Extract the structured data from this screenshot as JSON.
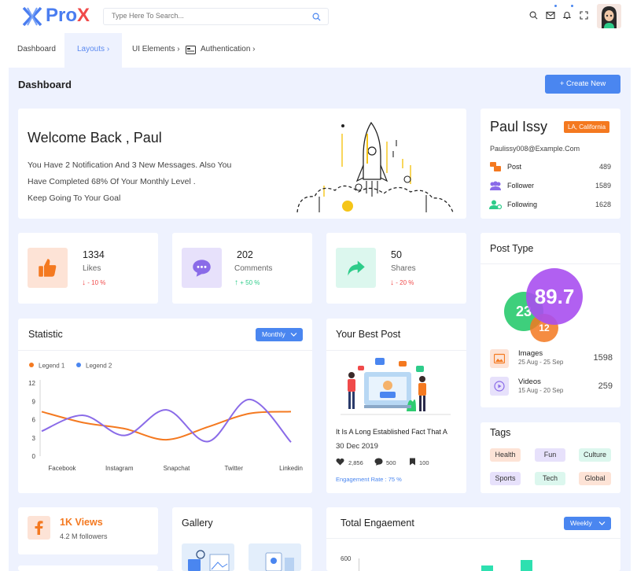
{
  "app": {
    "logo_prefix": "Pro",
    "logo_suffix": "X"
  },
  "search": {
    "placeholder": "Type Here To Search..."
  },
  "nav": [
    {
      "label": "Dashboard"
    },
    {
      "label": "Layouts",
      "chevron": "›"
    },
    {
      "label": "UI Elements",
      "chevron": "›"
    },
    {
      "label": "Authentication",
      "chevron": "›"
    }
  ],
  "page": {
    "title": "Dashboard",
    "create_button": "Create New",
    "create_icon": "+"
  },
  "welcome": {
    "title": "Welcome Back , Paul",
    "lines": [
      "You Have 2 Notification And 3 New Messages. Also You",
      "Have Completed 68% Of Your Monthly Level .",
      "Keep Going To Your Goal"
    ]
  },
  "profile": {
    "name": "Paul Issy",
    "location": "LA, California",
    "email": "Paulissy008@Example.Com",
    "stats": [
      {
        "label": "Post",
        "value": "489",
        "icon": "post-icon",
        "color": "#f47920"
      },
      {
        "label": "Follower",
        "value": "1589",
        "icon": "followers-icon",
        "color": "#8a6be8"
      },
      {
        "label": "Following",
        "value": "1628",
        "icon": "following-icon",
        "color": "#2ecc8a"
      }
    ]
  },
  "stats": [
    {
      "value": "1334",
      "label": "Likes",
      "trend": "- 10 %",
      "direction": "down",
      "icon": "thumbs-up-icon",
      "bg": "#fde3d6",
      "fg": "#f47920",
      "trend_color": "#f04a4a"
    },
    {
      "value": "202",
      "label": "Comments",
      "trend": "+ 50 %",
      "direction": "up",
      "icon": "comment-icon",
      "bg": "#e7e1fb",
      "fg": "#8a6be8",
      "trend_color": "#2ecc8a"
    },
    {
      "value": "50",
      "label": "Shares",
      "trend": "- 20 %",
      "direction": "down",
      "icon": "share-icon",
      "bg": "#dcf7ee",
      "fg": "#2ecc8a",
      "trend_color": "#f04a4a"
    }
  ],
  "statistic": {
    "title": "Statistic",
    "filter": "Monthly"
  },
  "chart_data": {
    "type": "line",
    "title": "Statistic",
    "categories": [
      "Facebook",
      "Instagram",
      "Snapchat",
      "Twitter",
      "Linkedin"
    ],
    "ylim": [
      0,
      12
    ],
    "yticks": [
      0,
      3,
      6,
      9,
      12
    ],
    "grid": false,
    "legend": "top-left",
    "series": [
      {
        "name": "Legend 1",
        "color": "#f47920",
        "values": [
          7.3,
          5.5,
          4.5,
          2.7,
          4.8,
          7.0,
          7.3
        ]
      },
      {
        "name": "Legend 2",
        "color": "#8a6be8",
        "values": [
          4.1,
          6.7,
          3.4,
          7.6,
          2.4,
          9.3,
          2.3
        ]
      }
    ]
  },
  "best_post": {
    "title": "Your Best Post",
    "headline": "It Is A Long Established Fact That A",
    "date": "30 Dec 2019",
    "likes": "2,856",
    "comments": "500",
    "bookmarks": "100",
    "engagement": "Engagement Rate : 75 %"
  },
  "post_type": {
    "title": "Post Type",
    "bubbles": [
      {
        "value": "89.7",
        "color": "#a94ff0"
      },
      {
        "value": "23",
        "color": "#2ecc71"
      },
      {
        "value": "12",
        "color": "#f47920"
      }
    ],
    "items": [
      {
        "label": "Images",
        "dates": "25 Aug - 25 Sep",
        "value": "1598",
        "icon": "image-icon",
        "bg": "#fde3d6",
        "fg": "#f47920"
      },
      {
        "label": "Videos",
        "dates": "15 Aug - 20 Sep",
        "value": "259",
        "icon": "video-icon",
        "bg": "#e7e1fb",
        "fg": "#8a6be8"
      }
    ]
  },
  "tags": {
    "title": "Tags",
    "items": [
      {
        "label": "Health",
        "bg": "#fde3d6"
      },
      {
        "label": "Fun",
        "bg": "#e7e1fb"
      },
      {
        "label": "Culture",
        "bg": "#dcf7ee"
      },
      {
        "label": "Sports",
        "bg": "#e7e1fb"
      },
      {
        "label": "Tech",
        "bg": "#dcf7ee"
      },
      {
        "label": "Global",
        "bg": "#fde3d6"
      }
    ]
  },
  "views": {
    "value": "1K Views",
    "followers": "4.2 M followers",
    "icon": "facebook-icon"
  },
  "gallery": {
    "title": "Gallery"
  },
  "engagement": {
    "title": "Total Engaement",
    "filter": "Weekly",
    "ytick": "600"
  }
}
